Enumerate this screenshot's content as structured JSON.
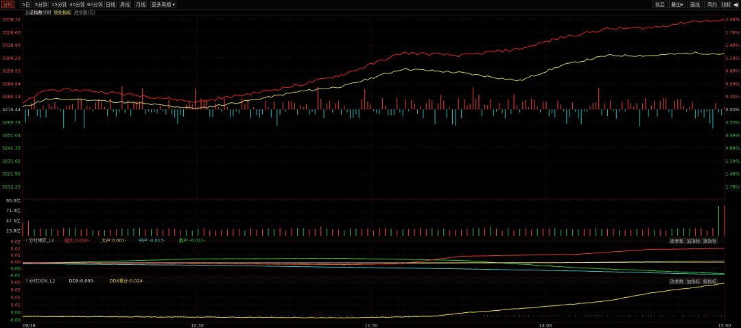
{
  "toolbar": {
    "periods": [
      "分时",
      "5日",
      "5分钟",
      "15分钟",
      "30分钟",
      "60分钟",
      "日线",
      "周线",
      "月线",
      "更多周期"
    ],
    "more_arrow": "▾",
    "right_buttons": [
      "前后",
      "叠加",
      "画线",
      "简约",
      "指标"
    ],
    "right_dd": "▾",
    "right_arrows": "◀▶"
  },
  "main_panel": {
    "legend": {
      "name": "上证指数",
      "mode": "分时",
      "lead": "领先指标",
      "turnover": "成交额(元)"
    },
    "y_left": [
      "3338.32",
      "3328.63",
      "3318.93",
      "3309.23",
      "3299.53",
      "3280.84",
      "3280.14",
      "3270.44",
      "3260.74",
      "3251.04",
      "3241.35",
      "3231.65",
      "3221.95",
      "3212.25"
    ],
    "y_right": [
      "2.08%",
      "1.78%",
      "1.48%",
      "1.19%",
      "0.89%",
      "0.59%",
      "0.30%",
      "0.00%",
      "0.30%",
      "0.59%",
      "0.89%",
      "1.19%",
      "1.48%",
      "1.78%"
    ]
  },
  "volume_panel": {
    "y_labels": [
      "95.0亿",
      "71.3亿",
      "47.5亿",
      "23.8亿"
    ]
  },
  "l2_panel": {
    "title": "分时博弈_L2",
    "items": [
      {
        "text": "超大:0.024-",
        "color": "#ff3a3a"
      },
      {
        "text": "大户:0.001-",
        "color": "#e8d84a"
      },
      {
        "text": "中户:-0.013-",
        "color": "#3fd0d0"
      },
      {
        "text": "散户:-0.011-",
        "color": "#33dd33"
      }
    ],
    "y_labels": [
      "0.02",
      "0.01",
      "0.01",
      "-0.00",
      "-0.00",
      "-0.01"
    ],
    "buttons": [
      "改参数",
      "加指标",
      "换指标"
    ]
  },
  "ddx_panel": {
    "title": "分时DDX_L2",
    "items": [
      {
        "text": "DDX:0.000-",
        "color": "#e6e6e6"
      },
      {
        "text": "DDX累计:0.024-",
        "color": "#e8d84a"
      }
    ],
    "y_labels": [
      "0.02",
      "0.02",
      "0.01",
      "0.01",
      "0.00",
      "-0.00"
    ],
    "buttons": [
      "改参数",
      "加指标",
      "换指标"
    ]
  },
  "x_axis": [
    "09/18",
    "10:30",
    "11:30",
    "14:00",
    "15:00"
  ],
  "colors": {
    "price": "#e8e85a",
    "lead": "#ff2222",
    "up": "#ff4040",
    "down": "#1fbfbf",
    "vol": "#2cc05a",
    "axis_up": "#ff4a4a",
    "axis_down": "#35d135",
    "grid": "#8b1a1a"
  }
}
